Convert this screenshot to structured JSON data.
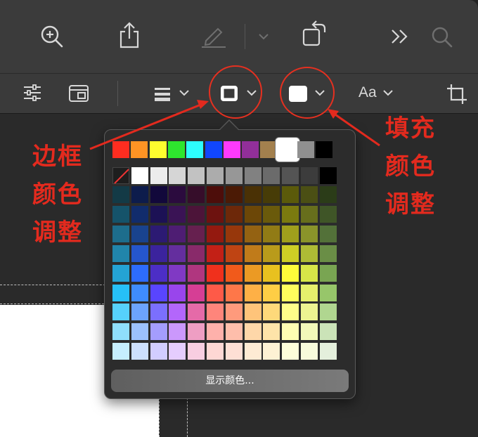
{
  "toolbar_top": {
    "zoom_icon": "zoom-in-icon",
    "share_icon": "share-icon",
    "markup_icon": "pencil-icon",
    "rotate_icon": "rotate-icon",
    "more_icon": "chevron-double-right-icon",
    "search_icon": "search-icon"
  },
  "toolbar_second": {
    "adjust_icon": "sliders-icon",
    "layout_icon": "layout-icon",
    "align_icon": "align-lines-icon",
    "border_color_icon": "border-square-icon",
    "fill_color_icon": "fill-square-icon",
    "text_style_label": "Aa",
    "crop_icon": "crop-icon"
  },
  "color_popover": {
    "show_colors_label": "显示颜色...",
    "top_row_colors": [
      "#fe2d20",
      "#fe9424",
      "#fefd2e",
      "#2ee52e",
      "#2dfdfd",
      "#1146fd",
      "#fe3afd",
      "#922f9a",
      "#a3804e",
      "#ffffff",
      "#909090",
      "#000000"
    ],
    "grayscale_row": [
      "none",
      "#ffffff",
      "#ececec",
      "#d6d6d6",
      "#c2c2c2",
      "#acacac",
      "#979797",
      "#818181",
      "#6b6b6b",
      "#545454",
      "#3c3c3c",
      "#000000"
    ],
    "grid_rows": [
      [
        "#133a46",
        "#0d1c4c",
        "#12083b",
        "#2b0b3e",
        "#360d2a",
        "#4d0d0a",
        "#4b1a05",
        "#4a3105",
        "#473c07",
        "#5b5a0a",
        "#4b4f14",
        "#2b3c18"
      ],
      [
        "#15536a",
        "#112c6c",
        "#1c1155",
        "#3a1355",
        "#4c1439",
        "#6d120f",
        "#6d2809",
        "#6c4707",
        "#6a5a0b",
        "#7b7a0f",
        "#676e1c",
        "#3f5527"
      ],
      [
        "#1d6d8c",
        "#19438e",
        "#2c1a73",
        "#4e1d73",
        "#66204f",
        "#94190f",
        "#97370b",
        "#946212",
        "#917b15",
        "#a09f1c",
        "#8a942a",
        "#537139"
      ],
      [
        "#2185ab",
        "#2556cd",
        "#3b239d",
        "#642e9e",
        "#892a6a",
        "#c32016",
        "#bf4413",
        "#c07b1a",
        "#b99b1b",
        "#cece25",
        "#aebb35",
        "#6a8e46"
      ],
      [
        "#24a3d4",
        "#2d6cfd",
        "#4c2ec6",
        "#8039c4",
        "#b0367f",
        "#f0301c",
        "#f15a1b",
        "#eb9a24",
        "#e8c11f",
        "#fdfb3a",
        "#d7e648",
        "#79a552"
      ],
      [
        "#26c0f7",
        "#3f8cfd",
        "#5945fe",
        "#9945ec",
        "#d63e95",
        "#fe5a48",
        "#fe7749",
        "#feb046",
        "#fece45",
        "#fefd5d",
        "#e6ef6c",
        "#97c66a"
      ],
      [
        "#56d1fb",
        "#6ca4fd",
        "#7b6ffe",
        "#b366fb",
        "#e56aa8",
        "#fe857b",
        "#fe9a7c",
        "#fec47a",
        "#fed97a",
        "#fefd8a",
        "#edf491",
        "#b0d690"
      ],
      [
        "#8fdefc",
        "#9cc1fd",
        "#a49dfe",
        "#cb98fc",
        "#ee9ec3",
        "#feb1ab",
        "#febeab",
        "#fed7a9",
        "#fee4a9",
        "#fefdb3",
        "#f2f8b9",
        "#cbe3b8"
      ],
      [
        "#c6eefe",
        "#cde0fe",
        "#d2cdff",
        "#e5cdfe",
        "#f8cee1",
        "#fed7d4",
        "#fedfd5",
        "#feebd4",
        "#fef2d4",
        "#fefed9",
        "#f8fbdb",
        "#e4efdc"
      ]
    ]
  },
  "annotations": {
    "left_label_lines": [
      "边框",
      "颜色",
      "调整"
    ],
    "right_label_lines": [
      "填充",
      "颜色",
      "调整"
    ],
    "accent_color": "#e32a1e"
  }
}
